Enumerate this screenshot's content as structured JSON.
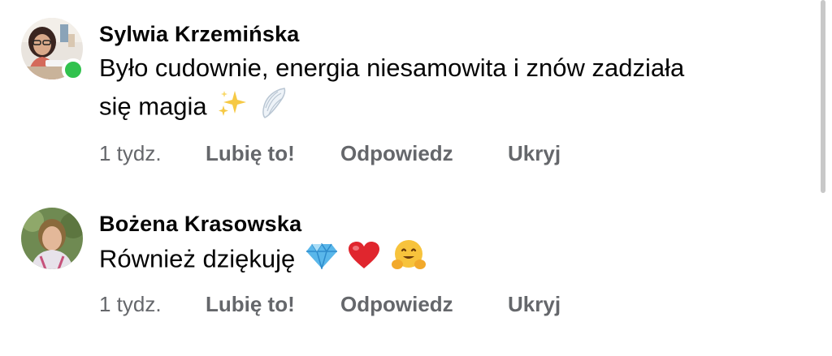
{
  "comments": [
    {
      "author": "Sylwia Krzemińska",
      "text_line1": "Było cudownie, energia niesamowita i znów zadziała",
      "text_line2": "się magia",
      "emojis": [
        "sparkles-emoji",
        "wing-emoji"
      ],
      "time": "1 tydz.",
      "like_label": "Lubię to!",
      "reply_label": "Odpowiedz",
      "hide_label": "Ukryj",
      "online": true
    },
    {
      "author": "Bożena Krasowska",
      "text": "Również dziękuję",
      "emojis": [
        "gem-emoji",
        "red-heart-emoji",
        "hugging-face-emoji"
      ],
      "time": "1 tydz.",
      "like_label": "Lubię to!",
      "reply_label": "Odpowiedz",
      "hide_label": "Ukryj",
      "online": false
    }
  ],
  "colors": {
    "text": "#050505",
    "secondary": "#65676b",
    "online": "#31c24d"
  }
}
